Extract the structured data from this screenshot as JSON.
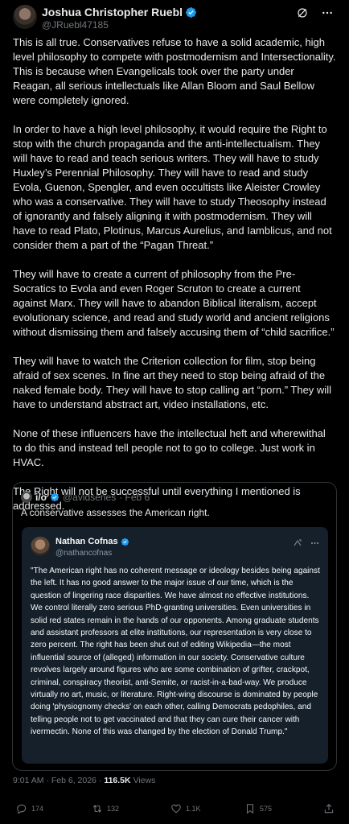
{
  "author": {
    "name": "Joshua Christopher Ruebl",
    "handle": "@JRuebl47185"
  },
  "post": {
    "paragraphs": [
      "This is all true.  Conservatives refuse to have a solid academic, high level philosophy to compete with postmodernism and Intersectionality.  This is because when Evangelicals took over the party under Reagan, all serious intellectuals like Allan Bloom and Saul Bellow were completely ignored.",
      "In order to have a high level philosophy, it would require the Right to stop with the church propaganda and the anti-intellectualism.  They will have to read and teach serious writers.  They will have to study Huxley’s Perennial Philosophy.  They will have to read and study Evola, Guenon, Spengler, and even occultists like Aleister Crowley who was a conservative. They will have to study Theosophy instead of ignorantly and falsely aligning it with postmodernism.  They will have to read Plato, Plotinus, Marcus Aurelius, and Iamblicus, and not consider them a part of the “Pagan Threat.”",
      "They will have to create a current of philosophy from the Pre-Socratics to Evola and even Roger Scruton to create a current against Marx.  They will have to abandon Biblical literalism, accept evolutionary science, and read and study world and ancient religions without dismissing them and falsely accusing them of “child sacrifice.”",
      "They will have to watch the Criterion collection for film, stop being afraid of sex scenes.  In fine art they need to stop being afraid of the naked female body.  They will have to stop calling art “porn.”  They will have to understand abstract art, video installations, etc.",
      "None of these influencers have the intellectual heft and wherewithal to do this and instead tell people not to go to college.  Just work in HVAC.",
      "The Right will not be successful until everything I mentioned is addressed."
    ]
  },
  "quote": {
    "name": "i/o",
    "handle": "@avidseries",
    "date": "· Feb 6",
    "text": "A conservative assesses the American right.",
    "inner": {
      "name": "Nathan Cofnas",
      "handle": "@nathancofnas",
      "text": "\"The American right has no coherent message or ideology besides being against the left. It has no good answer to the major issue of our time, which is the question of lingering race disparities. We have almost no effective institutions. We control literally zero serious PhD-granting universities. Even universities in solid red states remain in the hands of our opponents. Among graduate students and assistant professors at elite institutions, our representation is very close to zero percent. The right has been shut out of editing Wikipedia—the most influential source of (alleged) information in our society. Conservative culture revolves largely around figures who are some combination of grifter, crackpot, criminal, conspiracy theorist, anti-Semite, or racist-in-a-bad-way. We produce virtually no art, music, or literature. Right-wing discourse is dominated by people doing 'physiognomy checks' on each other, calling Democrats pedophiles, and telling people not to get vaccinated and that they can cure their cancer with ivermectin. None of this was changed by the election of Donald Trump.\""
    }
  },
  "meta": {
    "time": "9:01 AM · Feb 6, 2026 ·",
    "views_count": "116.5K",
    "views_label": "Views"
  },
  "actions": {
    "replies": "174",
    "reposts": "132",
    "likes": "1.1K",
    "bookmarks": "575"
  },
  "colors": {
    "background": "#000000",
    "text": "#e7e9ea",
    "muted": "#71767b",
    "verified": "#1d9bf0",
    "inner_card": "#15202b"
  }
}
